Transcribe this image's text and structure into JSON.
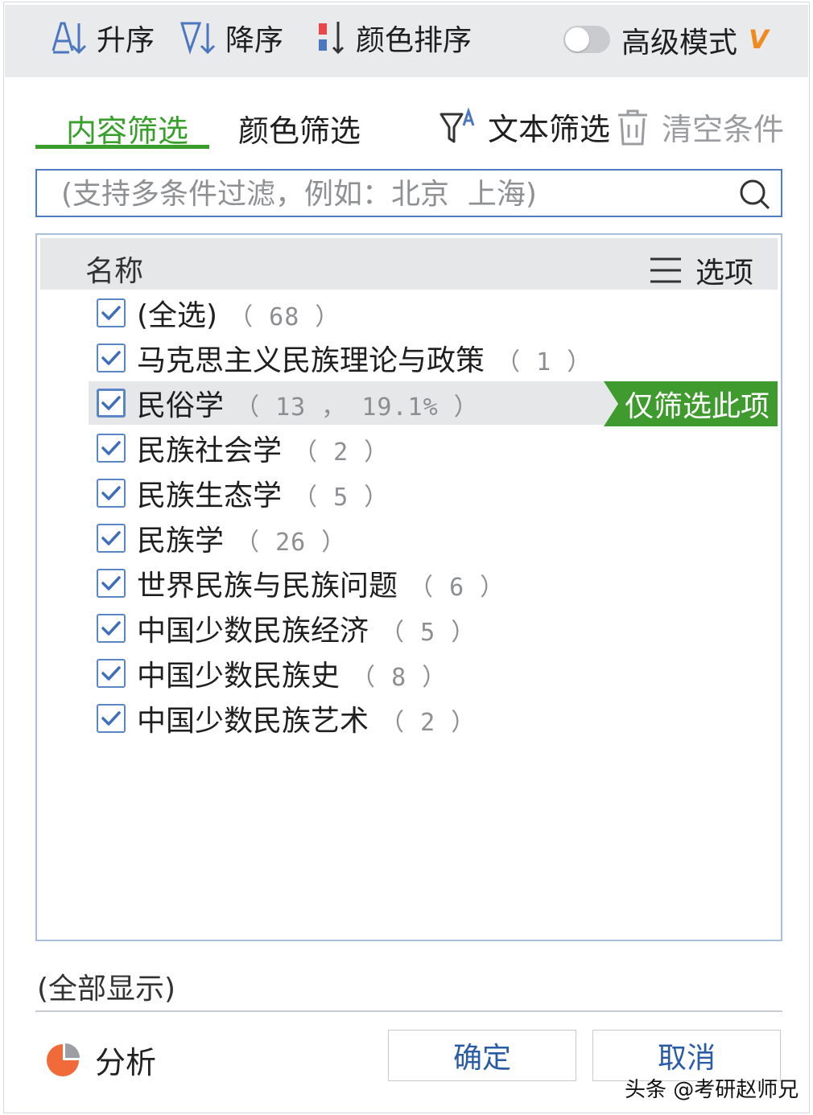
{
  "toolbar": {
    "sort_asc": "升序",
    "sort_desc": "降序",
    "color_sort": "颜色排序",
    "advanced_mode": "高级模式",
    "vip_badge": "V",
    "advanced_enabled": false
  },
  "tabs": {
    "content_filter": "内容筛选",
    "color_filter": "颜色筛选",
    "text_filter": "文本筛选",
    "clear_conditions": "清空条件"
  },
  "search": {
    "placeholder": "(支持多条件过滤，例如：北京  上海)",
    "value": ""
  },
  "list": {
    "header_name": "名称",
    "header_options": "选项",
    "items": [
      {
        "label": "(全选)",
        "count": "（ 68 ）",
        "checked": true
      },
      {
        "label": "马克思主义民族理论与政策",
        "count": "（ 1 ）",
        "checked": true
      },
      {
        "label": "民俗学",
        "count": "（ 13 ， 19.1% ）",
        "checked": true
      },
      {
        "label": "民族社会学",
        "count": "（ 2 ）",
        "checked": true
      },
      {
        "label": "民族生态学",
        "count": "（ 5 ）",
        "checked": true
      },
      {
        "label": "民族学",
        "count": "（ 26 ）",
        "checked": true
      },
      {
        "label": "世界民族与民族问题",
        "count": "（ 6 ）",
        "checked": true
      },
      {
        "label": "中国少数民族经济",
        "count": "（ 5 ）",
        "checked": true
      },
      {
        "label": "中国少数民族史",
        "count": "（ 8 ）",
        "checked": true
      },
      {
        "label": "中国少数民族艺术",
        "count": "（ 2 ）",
        "checked": true
      }
    ],
    "only_this_button": "仅筛选此项"
  },
  "footer": {
    "show_all": "(全部显示)",
    "analyze": "分析",
    "ok": "确定",
    "cancel": "取消"
  },
  "watermark": "头条 @考研赵师兄",
  "colors": {
    "accent_green": "#3a9e2c",
    "accent_blue": "#4f7ec2",
    "vip_orange": "#f08a1e"
  }
}
